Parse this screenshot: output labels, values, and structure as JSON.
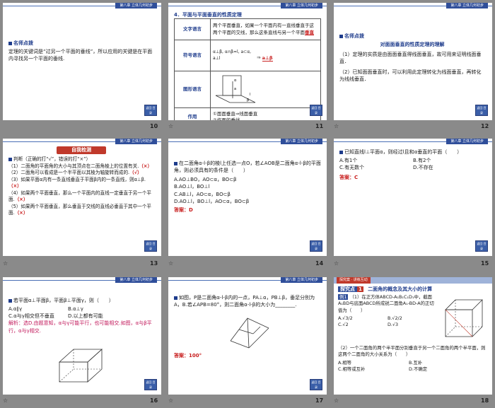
{
  "header_tag": "第八章  立体几何初步",
  "nav_label": "返回 目录",
  "star": "☆",
  "slides": {
    "s10": {
      "number": "10",
      "heading": "名师点拨",
      "body": "定理的关键词是“过另一个平面的垂线”，所以应用的关键是在平面内寻找另一个平面的垂线."
    },
    "s11": {
      "number": "11",
      "title": "4．平面与平面垂直的性质定理",
      "rows": [
        {
          "label": "文字语言",
          "text": "两个平面垂直，如果一个平面内有一直线垂直于这两个平面的交线，那么这条直线与另一个平面",
          "hl": "垂直"
        },
        {
          "label": "符号语言",
          "text": "α⊥β, α∩β=l, a⊂α, a⊥l",
          "hl": "a⊥β"
        },
        {
          "label": "图形语言",
          "text": ""
        },
        {
          "label": "作用",
          "text": "①面面垂直⇒线面垂直\n②作面的垂线"
        }
      ]
    },
    "s12": {
      "number": "12",
      "heading": "名师点拨",
      "subtitle": "对面面垂直的性质定理的理解",
      "p1": "（1）定理的实质是由面面垂直得线面垂直，故可用来证明线面垂直．",
      "p2": "（2）已知面面垂直时，可以利用此定理转化为线面垂直，再转化为线线垂直．"
    },
    "s13": {
      "number": "13",
      "banner": "自我检测",
      "q0": "判断（正确的打“√”，错误的打“×”）",
      "items": [
        {
          "text": "（1）二面角的平面角的大小与其顶点在二面角棱上的位置有关.",
          "ans": "（×）"
        },
        {
          "text": "（2）二面角可以看成是一个半平面以其棱为轴旋转而成的.",
          "ans": "（√）"
        },
        {
          "text": "（3）如果平面α内有一条直线垂直于平面β内的一条直线，则α⊥β.",
          "ans": "（×）"
        },
        {
          "text": "（4）如果两个平面垂直，那么一个平面内的直线一定垂直于另一个平面.",
          "ans": "（×）"
        },
        {
          "text": "（5）如果两个平面垂直，那么垂直于交线的直线必垂直于其中一个平面.",
          "ans": "（×）"
        }
      ]
    },
    "s14": {
      "number": "14",
      "q": "在二面角α-l-β的棱l上任选一点O，若∠AOB是二面角α-l-β的平面角，则必须具有的条件是（　　）",
      "options": [
        "A.AO⊥BO，AO⊂α，BO⊂β",
        "B.AO⊥l，BO⊥l",
        "C.AB⊥l，AO⊂α，BO⊂β",
        "D.AO⊥l，BO⊥l，AO⊂α，BO⊂β"
      ],
      "answer": "答案：D"
    },
    "s15": {
      "number": "15",
      "q": "已知直线l⊥平面α，则经过l且和α垂直的平面（　　）",
      "options": [
        "A.有1个",
        "B.有2个",
        "C.有无数个",
        "D.不存在"
      ],
      "answer": "答案：C"
    },
    "s16": {
      "number": "16",
      "q": "若平面α⊥平面β，平面β⊥平面γ，则（　　）",
      "options": [
        "A.α∥γ",
        "B.α⊥γ",
        "C.α与γ相交但不垂直",
        "D.以上都有可能"
      ],
      "analysis": "解析：选D.由题意知，α与γ可能平行，也可能相交.如图，α与β平行，α与γ相交."
    },
    "s17": {
      "number": "17",
      "q": "如图，P是二面角α-l-β内的一点，PA⊥α，PB⊥β，垂足分别为A，B.若∠APB=80°，则二面角α-l-β的大小为________.",
      "answer": "答案：100°"
    },
    "s18": {
      "number": "18",
      "top_banner": "探究案 · 讲练互动",
      "tag_label": "探究点",
      "tag_num": "1",
      "topic": "二面角的概念及其大小的计算",
      "ex_label": "例1",
      "q1": "（1）在正方体ABCD-A₁B₁C₁D₁中，截面A₁BD与底面ABCD所成锐二面角A₁-BD-A的正切值为（　　）",
      "opts1": [
        "A.√3/2",
        "B.√2/2",
        "C.√2",
        "D.√3"
      ],
      "q2": "（2）一个二面角的两个半平面分别垂直于另一个二面角的两个半平面，则这两个二面角的大小关系为（　　）",
      "opts2": [
        "A.相等",
        "B.互补",
        "C.相等或互补",
        "D.不确定"
      ]
    }
  }
}
